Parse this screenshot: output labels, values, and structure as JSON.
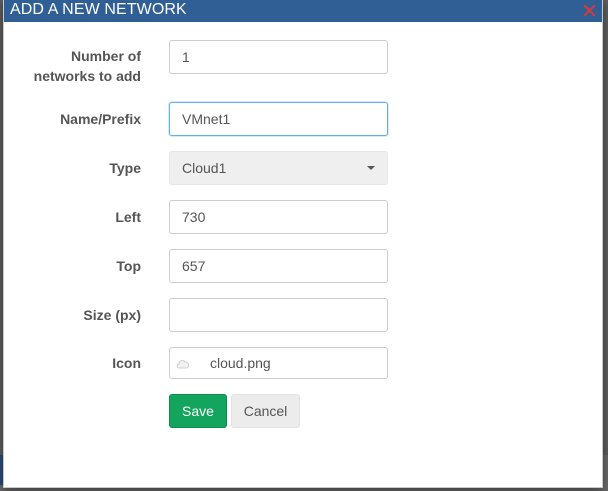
{
  "dialog": {
    "title": "ADD A NEW NETWORK"
  },
  "form": {
    "count": {
      "label_line1": "Number of",
      "label_line2": "networks to add",
      "value": "1"
    },
    "name": {
      "label": "Name/Prefix",
      "value": "VMnet1"
    },
    "type": {
      "label": "Type",
      "selected": "Cloud1"
    },
    "left": {
      "label": "Left",
      "value": "730"
    },
    "top": {
      "label": "Top",
      "value": "657"
    },
    "size": {
      "label": "Size (px)",
      "value": ""
    },
    "icon": {
      "label": "Icon",
      "value": "cloud.png"
    }
  },
  "buttons": {
    "save": "Save",
    "cancel": "Cancel"
  },
  "colors": {
    "header": "#2f5f95",
    "save": "#13a45d",
    "close_icon": "#d23c3c"
  }
}
